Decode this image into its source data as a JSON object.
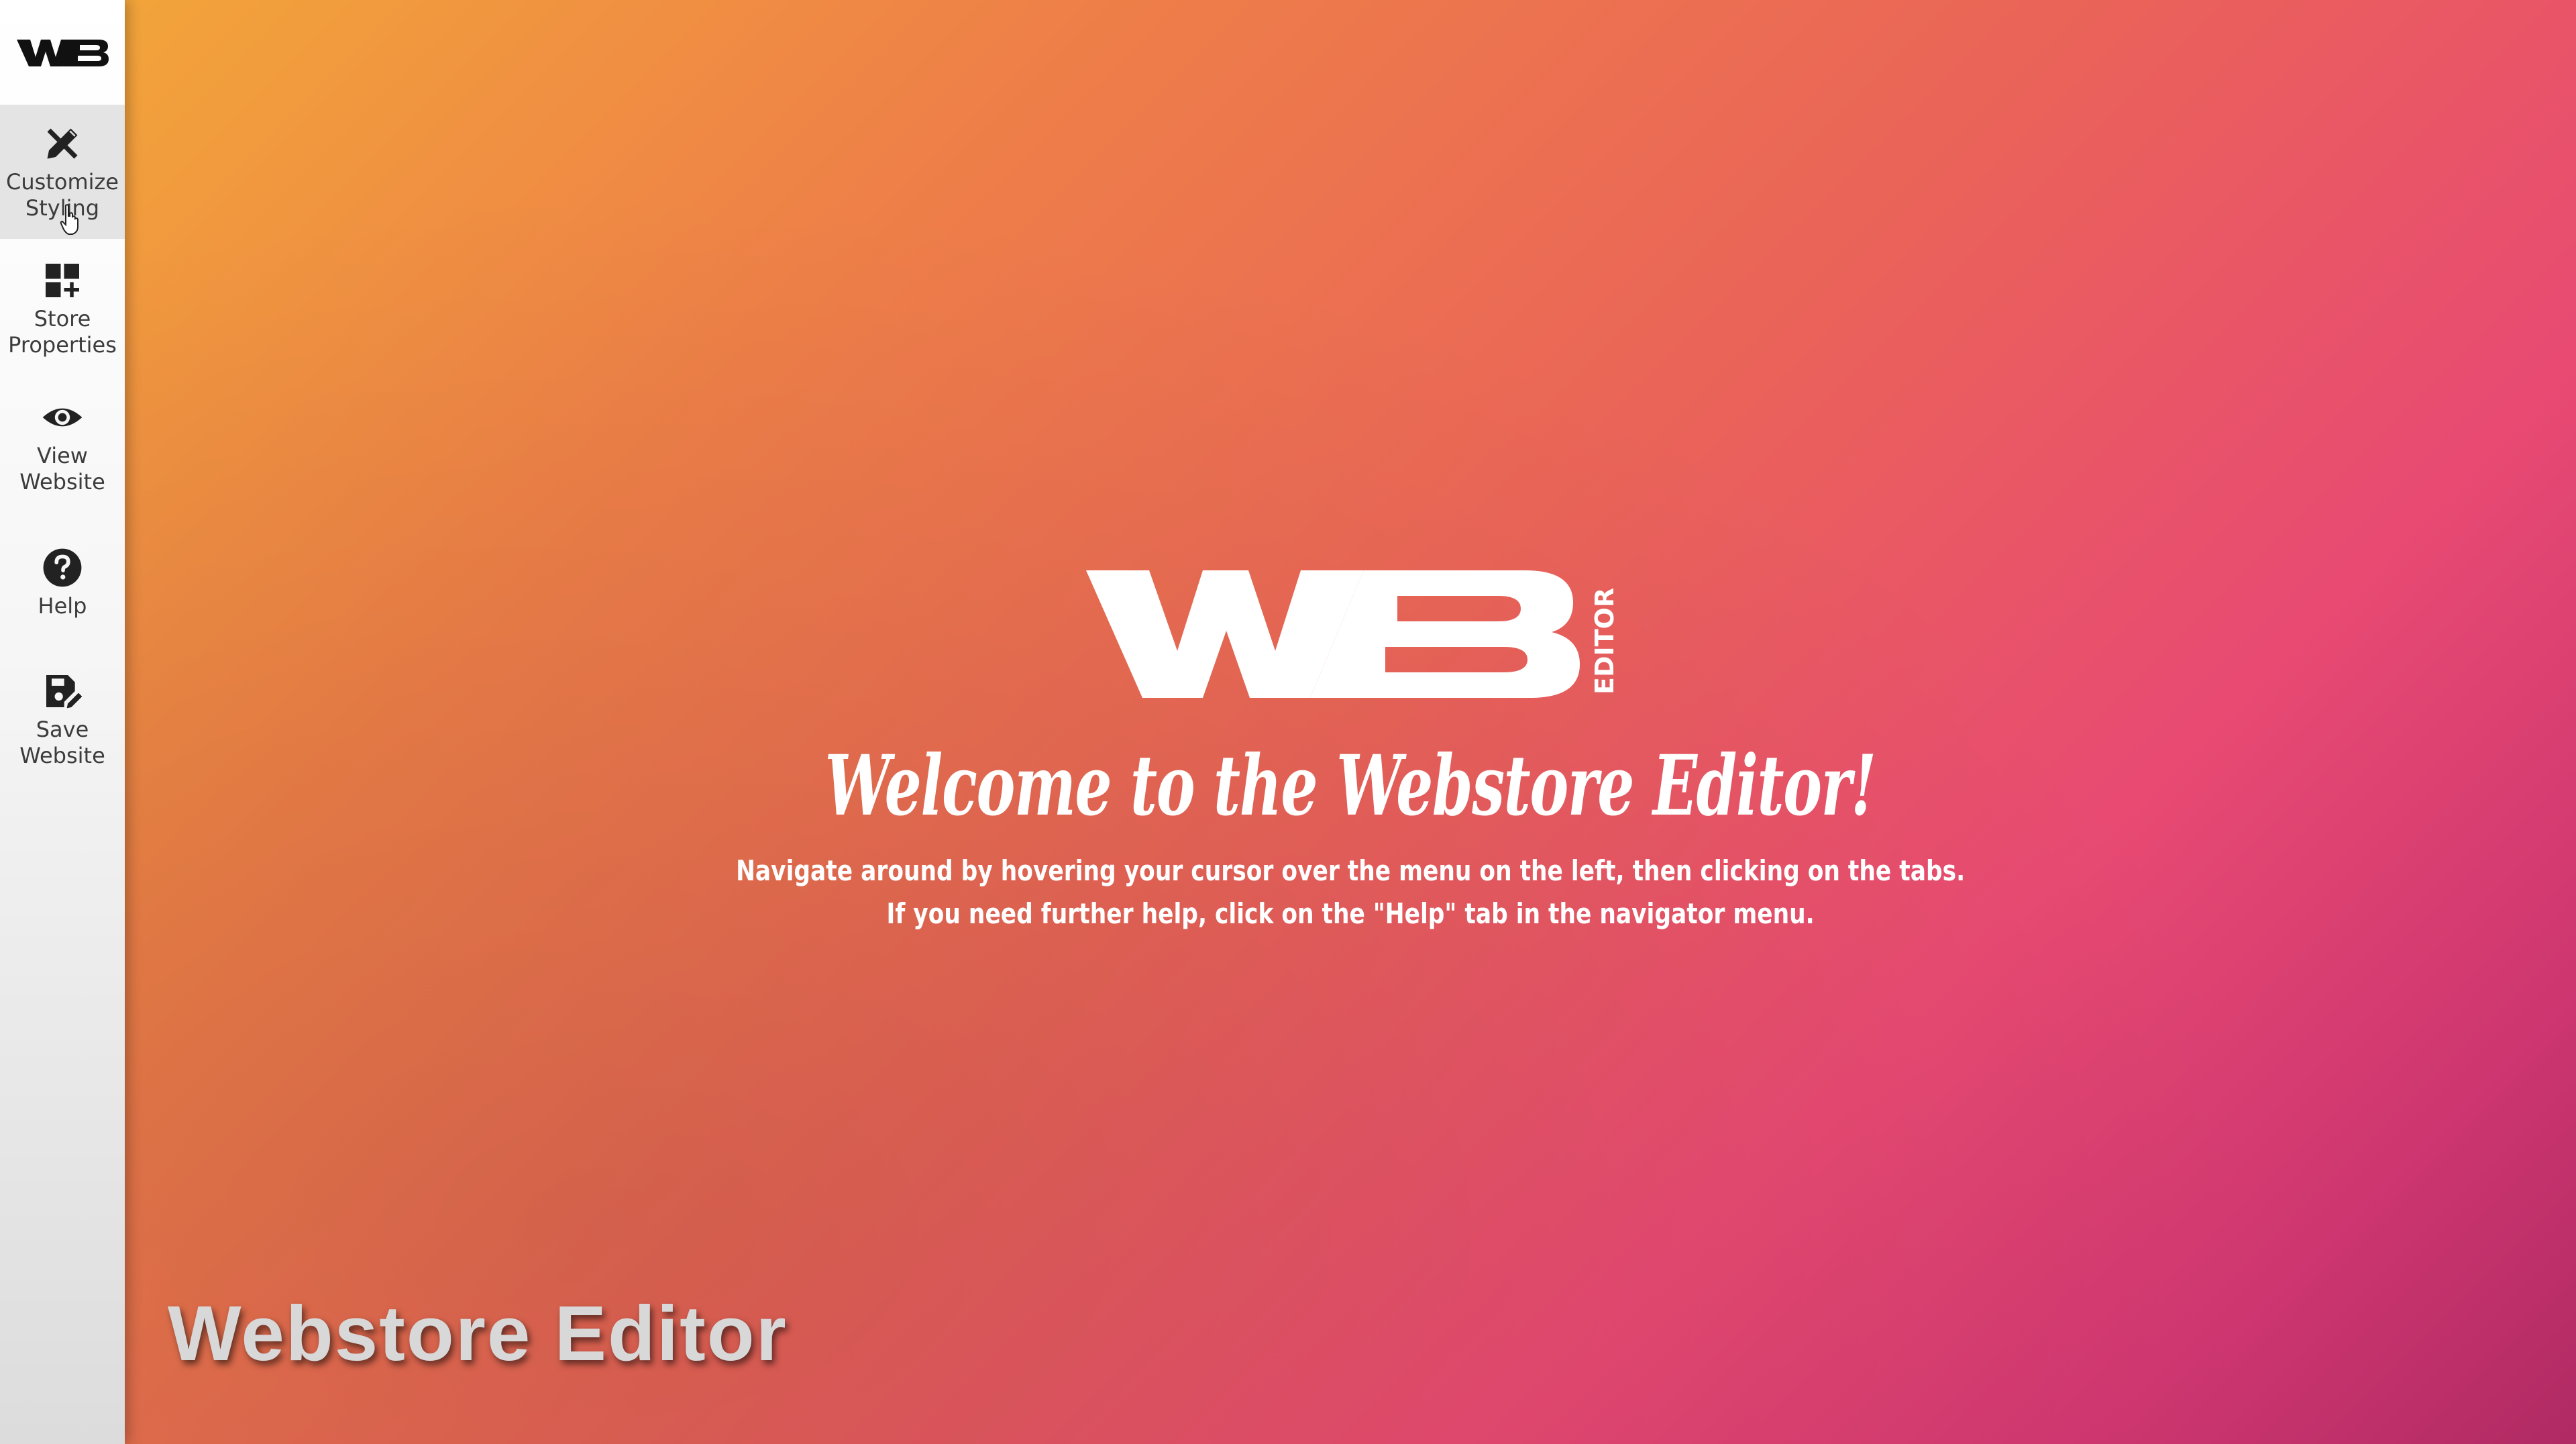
{
  "app": {
    "logo_text": "WB"
  },
  "sidebar": {
    "items": [
      {
        "label": "Customize\nStyling",
        "icon": "wrench-pencil-icon",
        "active": true
      },
      {
        "label": "Store\nProperties",
        "icon": "grid-plus-icon",
        "active": false
      },
      {
        "label": "View\nWebsite",
        "icon": "eye-icon",
        "active": false
      },
      {
        "label": "Help",
        "icon": "question-icon",
        "active": false
      },
      {
        "label": "Save\nWebsite",
        "icon": "save-edit-icon",
        "active": false
      }
    ]
  },
  "main": {
    "logo_text": "WB",
    "logo_sub": "EDITOR",
    "welcome_title": "Welcome to the Webstore Editor!",
    "instructions_line1": "Navigate around by hovering your cursor over the menu on the left, then clicking on the tabs.",
    "instructions_line2": "If you need further help, click on the \"Help\" tab in the navigator menu."
  },
  "overlay": {
    "watermark": "Webstore Editor"
  },
  "colors": {
    "gradient_start": "#f2a43a",
    "gradient_mid": "#ea6458",
    "gradient_end": "#b02a63",
    "sidebar_bg": "#f6f6f6",
    "active_item_bg": "#e4e4e4"
  }
}
